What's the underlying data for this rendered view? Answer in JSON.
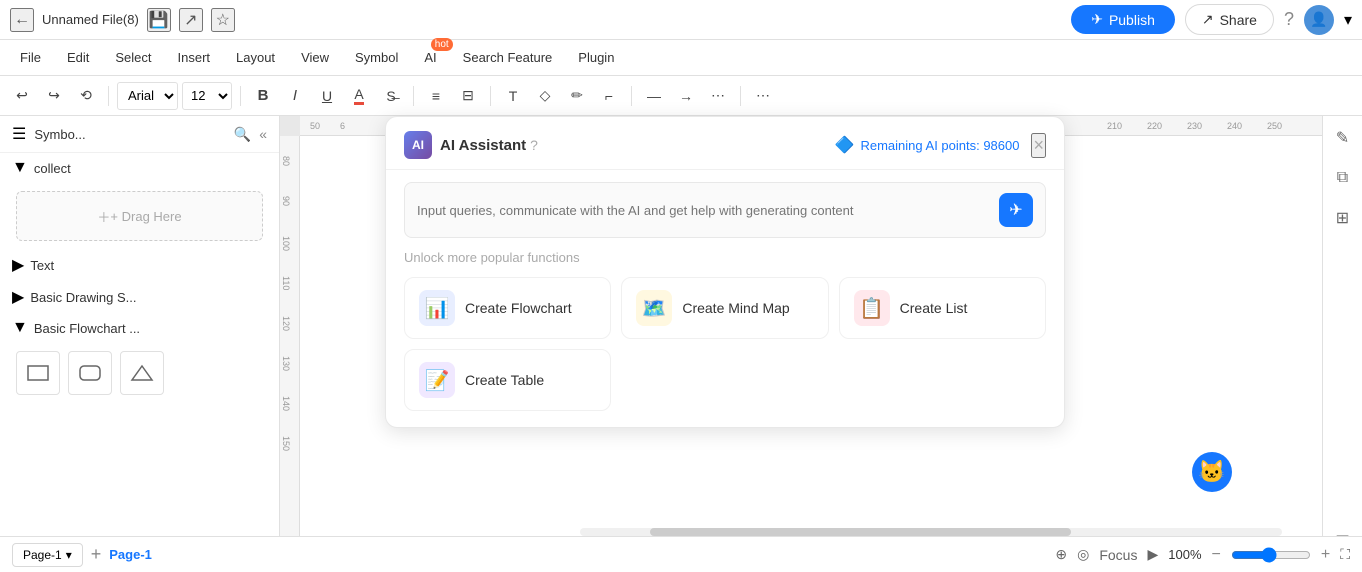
{
  "titleBar": {
    "backLabel": "←",
    "fileName": "Unnamed File(8)",
    "saveIcon": "💾",
    "shareFileIcon": "↗",
    "starIcon": "☆",
    "publishLabel": "Publish",
    "shareLabel": "Share",
    "helpIcon": "?",
    "avatarInitial": "👤",
    "dropdownIcon": "▾"
  },
  "menuBar": {
    "items": [
      "File",
      "Edit",
      "Select",
      "Insert",
      "Layout",
      "View",
      "Symbol",
      "AI",
      "Search Feature",
      "Plugin"
    ],
    "aiBadge": "hot"
  },
  "toolbar": {
    "undoIcon": "↩",
    "redoIcon": "↪",
    "historyIcon": "⟲",
    "fontName": "Arial",
    "fontSize": "12",
    "boldLabel": "B",
    "italicLabel": "I",
    "underlineLabel": "U",
    "fontColorLabel": "A",
    "strikeLabel": "S̶",
    "alignCenterLabel": "≡",
    "alignDistLabel": "⊟",
    "textBoxIcon": "T",
    "fillIcon": "◇",
    "penIcon": "✏",
    "lineStyleIcon": "⌐",
    "lineThicknessIcon": "—",
    "arrowIcon": "→",
    "dashIcon": "⋯",
    "moreIcon": "⋯"
  },
  "sidebar": {
    "title": "Symbo...",
    "searchIcon": "🔍",
    "collapseIcon": "«",
    "expandIcon": "▾",
    "sections": [
      {
        "label": "collect",
        "expanded": true
      },
      {
        "label": "Text",
        "expanded": false
      },
      {
        "label": "Basic Drawing S...",
        "expanded": false
      },
      {
        "label": "Basic Flowchart ...",
        "expanded": true
      }
    ],
    "dragHereText": "+ Drag Here"
  },
  "canvas": {
    "rulerNumbers": [
      "50",
      "6",
      "210",
      "220",
      "230",
      "240",
      "250"
    ]
  },
  "bottomBar": {
    "pageTabLabel": "Page-1",
    "pageTabActive": "Page-1",
    "addPageIcon": "+",
    "layersIcon": "⊕",
    "focusLabel": "Focus",
    "focusPlayIcon": "▶",
    "zoomLevel": "100%",
    "zoomOutIcon": "−",
    "zoomInIcon": "+",
    "fullscreenIcon": "⛶"
  },
  "aiPanel": {
    "logoText": "AI",
    "title": "AI Assistant",
    "helpIcon": "?",
    "pointsLabel": "Remaining AI points: 98600",
    "closeIcon": "×",
    "inputPlaceholder": "Input queries, communicate with the AI and get help with generating content",
    "sendIcon": "✈",
    "unlockLabel": "Unlock more popular functions",
    "functions": [
      {
        "icon": "📊",
        "iconClass": "func-icon-blue",
        "label": "Create Flowchart"
      },
      {
        "icon": "🗺️",
        "iconClass": "func-icon-yellow",
        "label": "Create Mind Map"
      },
      {
        "icon": "📋",
        "iconClass": "func-icon-pink",
        "label": "Create List"
      },
      {
        "icon": "📝",
        "iconClass": "func-icon-purple",
        "label": "Create Table"
      }
    ]
  },
  "catAvatar": "🐱"
}
